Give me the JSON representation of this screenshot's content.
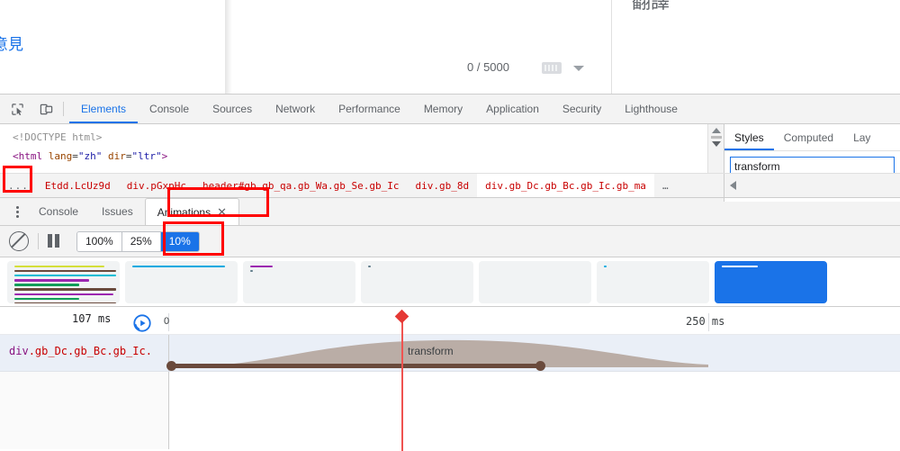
{
  "page_behind": {
    "feedback_link": "意見",
    "char_counter": "0 / 5000",
    "panel_title": "翻譯",
    "keyboard_icon": "keyboard-icon",
    "dropdown_icon": "chevron-down-icon"
  },
  "devtools": {
    "toolbar_icons": [
      {
        "name": "inspect-element-icon"
      },
      {
        "name": "device-toolbar-icon"
      }
    ],
    "tabs": [
      {
        "label": "Elements",
        "selected": true
      },
      {
        "label": "Console",
        "selected": false
      },
      {
        "label": "Sources",
        "selected": false
      },
      {
        "label": "Network",
        "selected": false
      },
      {
        "label": "Performance",
        "selected": false
      },
      {
        "label": "Memory",
        "selected": false
      },
      {
        "label": "Application",
        "selected": false
      },
      {
        "label": "Security",
        "selected": false
      },
      {
        "label": "Lighthouse",
        "selected": false
      }
    ],
    "elements_tree": {
      "line1": "<!DOCTYPE html>",
      "line2_tag_open": "<html",
      "line2_attr1": "lang",
      "line2_val1": "\"zh\"",
      "line2_attr2": "dir",
      "line2_val2": "\"ltr\"",
      "line2_close": ">"
    },
    "breadcrumbs": {
      "ellipsis": "...",
      "items": [
        "Etdd.LcUz9d",
        "div.pGxpHc",
        "header#gb.gb_qa.gb_Wa.gb_Se.gb_Ic",
        "div.gb_8d",
        "div.gb_Dc.gb_Bc.gb_Ic.gb_ma"
      ],
      "trailing_ellipsis": "…"
    },
    "styles_pane": {
      "tabs": [
        {
          "label": "Styles",
          "selected": true
        },
        {
          "label": "Computed",
          "selected": false
        },
        {
          "label": "Lay",
          "selected": false
        }
      ],
      "filter_value": "transform"
    }
  },
  "drawer": {
    "menu_icon": "kebab-menu-icon",
    "tabs": [
      {
        "label": "Console",
        "selected": false
      },
      {
        "label": "Issues",
        "selected": false
      },
      {
        "label": "Animations",
        "selected": true,
        "close_icon": "close-icon"
      }
    ]
  },
  "animations": {
    "toolbar": {
      "clear_icon": "clear-all-icon",
      "pause_icon": "pause-icon",
      "speeds": [
        {
          "label": "100%",
          "selected": false
        },
        {
          "label": "25%",
          "selected": false
        },
        {
          "label": "10%",
          "selected": true
        }
      ]
    },
    "accent_color": "#1a73e8",
    "preview_cards": [
      {
        "selected": false,
        "width": 125,
        "bars": [
          {
            "color": "#d4de3a",
            "width": 100
          },
          {
            "color": "#6a4a3c",
            "width": 113
          },
          {
            "color": "#00bcd4",
            "width": 113
          },
          {
            "color": "#9c27b0",
            "width": 83
          },
          {
            "color": "#0f9d58",
            "width": 72
          },
          {
            "color": "#6a4a3c",
            "width": 113
          },
          {
            "color": "#9c27b0",
            "width": 110
          },
          {
            "color": "#0f9d58",
            "width": 72
          },
          {
            "color": "#6a4a3c",
            "width": 113
          }
        ]
      },
      {
        "selected": false,
        "width": 125,
        "bars": [
          {
            "color": "#03a9e0",
            "width": 103
          }
        ]
      },
      {
        "selected": false,
        "width": 125,
        "bars": [
          {
            "color": "#9c27b0",
            "width": 25
          },
          {
            "color": "#607d8b",
            "width": 3
          }
        ]
      },
      {
        "selected": false,
        "width": 125,
        "bars": [
          {
            "color": "#607d8b",
            "width": 3
          }
        ]
      },
      {
        "selected": false,
        "width": 125,
        "bars": []
      },
      {
        "selected": false,
        "width": 125,
        "bars": [
          {
            "color": "#03a9e0",
            "width": 3
          }
        ]
      },
      {
        "selected": true,
        "width": 125,
        "bars": [
          {
            "color": "#ffffff",
            "width": 40
          }
        ]
      }
    ],
    "timeline": {
      "duration_label": "107 ms",
      "replay_icon": "replay-icon",
      "start_label": "0",
      "end_label": "250 ms",
      "row": {
        "selector_tag": "div",
        "selector_classes": ".gb_Dc.gb_Bc.gb_Ic.",
        "property_label": "transform",
        "keyframe_color": "#6a4a3c"
      }
    }
  },
  "annotations": [
    {
      "name": "breadcrumb-ellipsis-highlight"
    },
    {
      "name": "animations-tab-highlight"
    },
    {
      "name": "speed-10-percent-highlight"
    }
  ]
}
